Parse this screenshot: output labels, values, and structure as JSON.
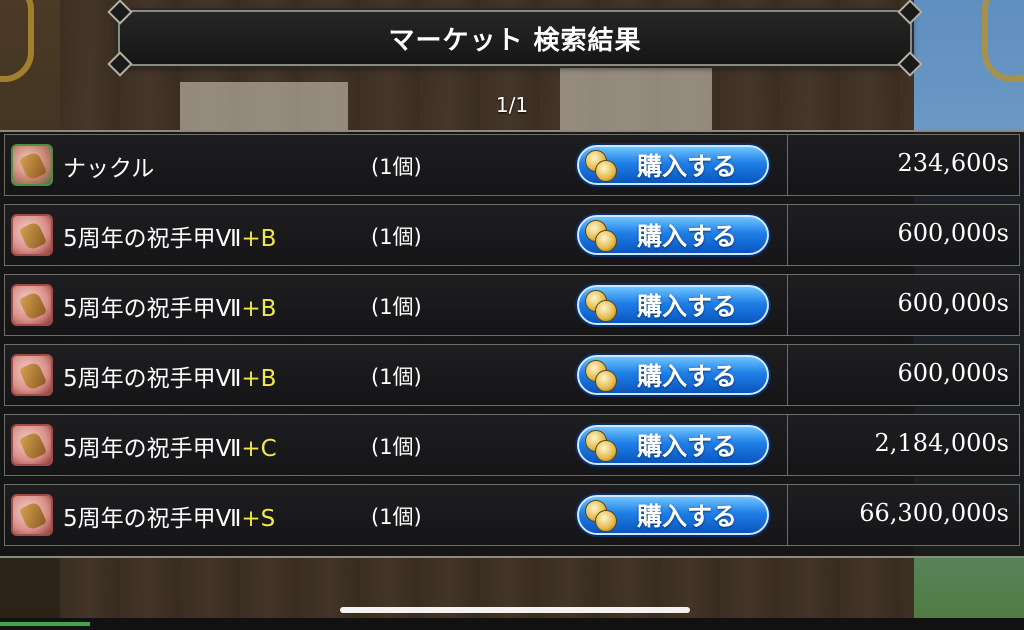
{
  "header": {
    "title": "マーケット 検索結果",
    "page_indicator": "1/1"
  },
  "listings": [
    {
      "icon": "knuckle-icon",
      "name": "ナックル",
      "grade": "",
      "count": "(1個)",
      "buy_label": "購入する",
      "price": "234,600s"
    },
    {
      "icon": "gauntlet-icon",
      "name": "5周年の祝手甲Ⅶ",
      "grade": "+B",
      "count": "(1個)",
      "buy_label": "購入する",
      "price": "600,000s"
    },
    {
      "icon": "gauntlet-icon",
      "name": "5周年の祝手甲Ⅶ",
      "grade": "+B",
      "count": "(1個)",
      "buy_label": "購入する",
      "price": "600,000s"
    },
    {
      "icon": "gauntlet-icon",
      "name": "5周年の祝手甲Ⅶ",
      "grade": "+B",
      "count": "(1個)",
      "buy_label": "購入する",
      "price": "600,000s"
    },
    {
      "icon": "gauntlet-icon",
      "name": "5周年の祝手甲Ⅶ",
      "grade": "+C",
      "count": "(1個)",
      "buy_label": "購入する",
      "price": "2,184,000s"
    },
    {
      "icon": "gauntlet-icon",
      "name": "5周年の祝手甲Ⅶ",
      "grade": "+S",
      "count": "(1個)",
      "buy_label": "購入する",
      "price": "66,300,000s"
    }
  ],
  "colors": {
    "grade_text": "#f2e84e",
    "buy_button": "#1f7fe6",
    "panel_bg": "#151517"
  }
}
